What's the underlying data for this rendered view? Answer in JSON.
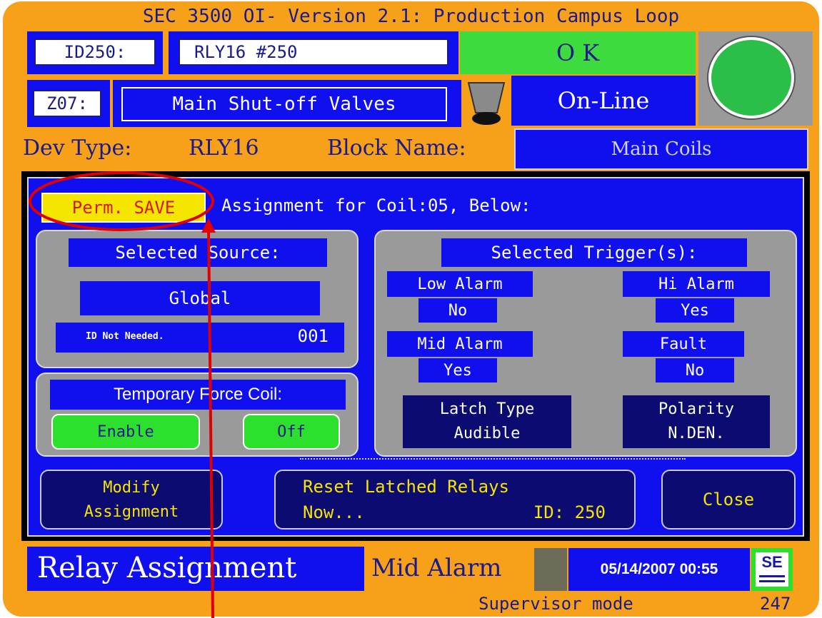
{
  "title": "SEC 3500 OI- Version 2.1: Production Campus Loop",
  "device": {
    "id_label": "ID250:",
    "id_value": "RLY16 #250",
    "zone_label": "Z07:",
    "zone_value": "Main Shut-off Valves",
    "status": "O K",
    "online": "On-Line",
    "dev_type_label": "Dev Type:",
    "dev_type_value": "RLY16",
    "block_name_label": "Block Name:",
    "block_name_value": "Main Coils"
  },
  "assignment": {
    "save_label": "Perm. SAVE",
    "heading": "Assignment for Coil:05, Below:"
  },
  "source": {
    "title": "Selected Source:",
    "value": "Global",
    "id_note": "ID Not Needed.",
    "id_value": "001"
  },
  "force": {
    "title": "Temporary Force Coil:",
    "enable_label": "Enable",
    "off_label": "Off"
  },
  "triggers": {
    "title": "Selected Trigger(s):",
    "low_alarm_label": "Low Alarm",
    "low_alarm_value": "No",
    "hi_alarm_label": "Hi Alarm",
    "hi_alarm_value": "Yes",
    "mid_alarm_label": "Mid Alarm",
    "mid_alarm_value": "Yes",
    "fault_label": "Fault",
    "fault_value": "No",
    "latch_label": "Latch Type",
    "latch_value": "Audible",
    "polarity_label": "Polarity",
    "polarity_value": "N.DEN."
  },
  "actions": {
    "modify_line1": "Modify",
    "modify_line2": "Assignment",
    "reset_line1": "Reset Latched Relays",
    "reset_line2": "Now...",
    "reset_id": "ID: 250",
    "close_label": "Close"
  },
  "footer": {
    "screen_name": "Relay Assignment",
    "alarm_text": "Mid Alarm",
    "datetime": "05/14/2007 00:55",
    "logo_text": "SE",
    "mode": "Supervisor mode",
    "number": "247"
  },
  "colors": {
    "frame": "#f7a11a",
    "panel_blue": "#1010ee",
    "navy": "#0b0b72",
    "ok_green": "#3ddb3d",
    "button_green": "#2ee02e",
    "save_yellow": "#f5e600",
    "annotation_red": "#e00000"
  },
  "icons": [
    "status-lamp-icon",
    "bell-icon",
    "sensor-electronics-logo",
    "annotation-arrow"
  ]
}
